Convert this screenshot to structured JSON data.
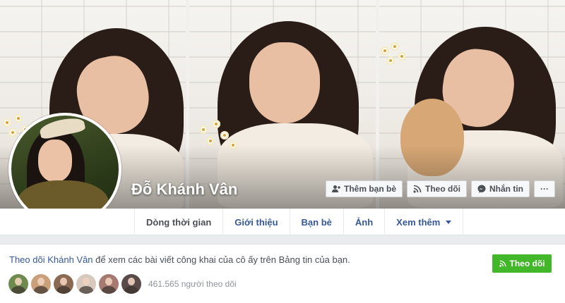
{
  "profile": {
    "name": "Đỗ Khánh Vân"
  },
  "cover_actions": {
    "add_friend": "Thêm bạn bè",
    "follow": "Theo dõi",
    "message": "Nhắn tin",
    "more": "···"
  },
  "tabs": [
    {
      "label": "Dòng thời gian",
      "active": true
    },
    {
      "label": "Giới thiệu"
    },
    {
      "label": "Bạn bè"
    },
    {
      "label": "Ảnh"
    },
    {
      "label": "Xem thêm"
    }
  ],
  "follow_box": {
    "link_text": "Theo dõi Khánh Vân",
    "rest_text": " để xem các bài viết công khai của cô ấy trên Bảng tin của bạn.",
    "button_label": "Theo dõi",
    "follower_count_text": "461.565 người theo dõi",
    "follower_avatar_colors": [
      "#6f8a4e",
      "#c9a07a",
      "#8a6a52",
      "#d8c9be",
      "#a67a70",
      "#5a4a4a"
    ]
  },
  "colors": {
    "link": "#365899",
    "follow_green": "#42b72a",
    "nav_border": "#dddfe2",
    "page_bg": "#e9ebee"
  }
}
